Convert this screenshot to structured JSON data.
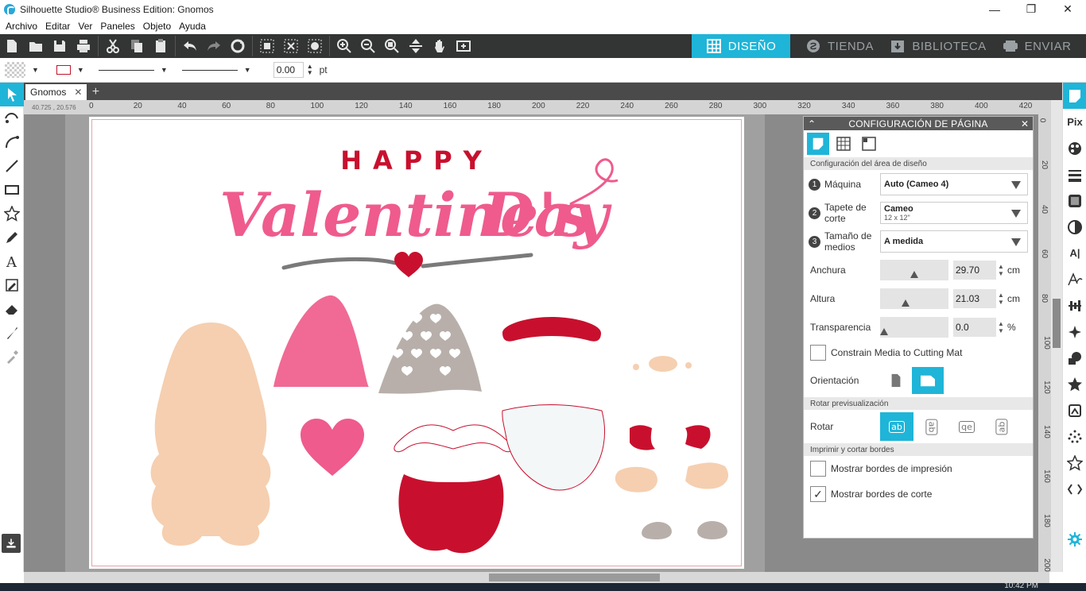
{
  "window": {
    "title": "Silhouette Studio® Business Edition: Gnomos",
    "minimize": "—",
    "maximize": "❐",
    "close": "✕"
  },
  "menu": [
    "Archivo",
    "Editar",
    "Ver",
    "Paneles",
    "Objeto",
    "Ayuda"
  ],
  "nav_tabs": [
    {
      "label": "DISEÑO",
      "active": true,
      "icon": "grid-icon"
    },
    {
      "label": "TIENDA",
      "active": false,
      "icon": "store-icon"
    },
    {
      "label": "BIBLIOTECA",
      "active": false,
      "icon": "library-icon"
    },
    {
      "label": "ENVIAR",
      "active": false,
      "icon": "send-icon"
    }
  ],
  "propbar": {
    "line_width_value": "0.00",
    "unit": "pt"
  },
  "document_tab": {
    "name": "Gnomos",
    "close": "✕",
    "add": "+"
  },
  "ruler": {
    "coords": "40.725 , 20.576",
    "h_labels": [
      "0",
      "20",
      "40",
      "60",
      "80",
      "100",
      "120",
      "140",
      "160",
      "180",
      "200",
      "220",
      "240",
      "260",
      "280",
      "300",
      "320",
      "340",
      "360",
      "380",
      "400",
      "420"
    ],
    "v_labels": [
      "0",
      "20",
      "40",
      "60",
      "80",
      "100",
      "120",
      "140",
      "160",
      "180",
      "200"
    ]
  },
  "artwork": {
    "happy": "HAPPY",
    "valentines": "Valentine's",
    "day": "Day",
    "colors": {
      "pink": "#ef5b8c",
      "hat_pink": "#f06a95",
      "red": "#c8102e",
      "skin": "#f5cfb0",
      "gray": "#b8afaa",
      "dark_gray": "#7a7a7a",
      "beard": "#f4f7f8"
    }
  },
  "panel": {
    "title": "CONFIGURACIÓN DE PÁGINA",
    "close": "✕",
    "section_design": "Configuración del área de diseño",
    "machine": {
      "step": "1",
      "label": "Máquina",
      "value": "Auto (Cameo 4)"
    },
    "mat": {
      "step": "2",
      "label": "Tapete de corte",
      "value": "Cameo",
      "sub": "12 x 12\""
    },
    "media": {
      "step": "3",
      "label": "Tamaño de medios",
      "value": "A medida"
    },
    "width": {
      "label": "Anchura",
      "value": "29.70",
      "unit": "cm",
      "level": 0.5
    },
    "height": {
      "label": "Altura",
      "value": "21.03",
      "unit": "cm",
      "level": 0.35
    },
    "transparency": {
      "label": "Transparencia",
      "value": "0.0",
      "unit": "%",
      "level": 0
    },
    "constrain": {
      "label": "Constrain Media to Cutting Mat",
      "checked": false
    },
    "orientation": {
      "label": "Orientación"
    },
    "section_rotate": "Rotar previsualización",
    "rotate": {
      "label": "Rotar",
      "options": [
        "ab",
        "ab",
        "qe",
        "ab"
      ]
    },
    "section_borders": "Imprimir y cortar bordes",
    "show_print": {
      "label": "Mostrar bordes de impresión",
      "checked": false
    },
    "show_cut": {
      "label": "Mostrar bordes de corte",
      "checked": true,
      "mark": "✓"
    }
  },
  "right_rail": {
    "pix": "Pix",
    "text_a": "A|"
  },
  "taskbar": {
    "clock": "10:42 PM"
  }
}
